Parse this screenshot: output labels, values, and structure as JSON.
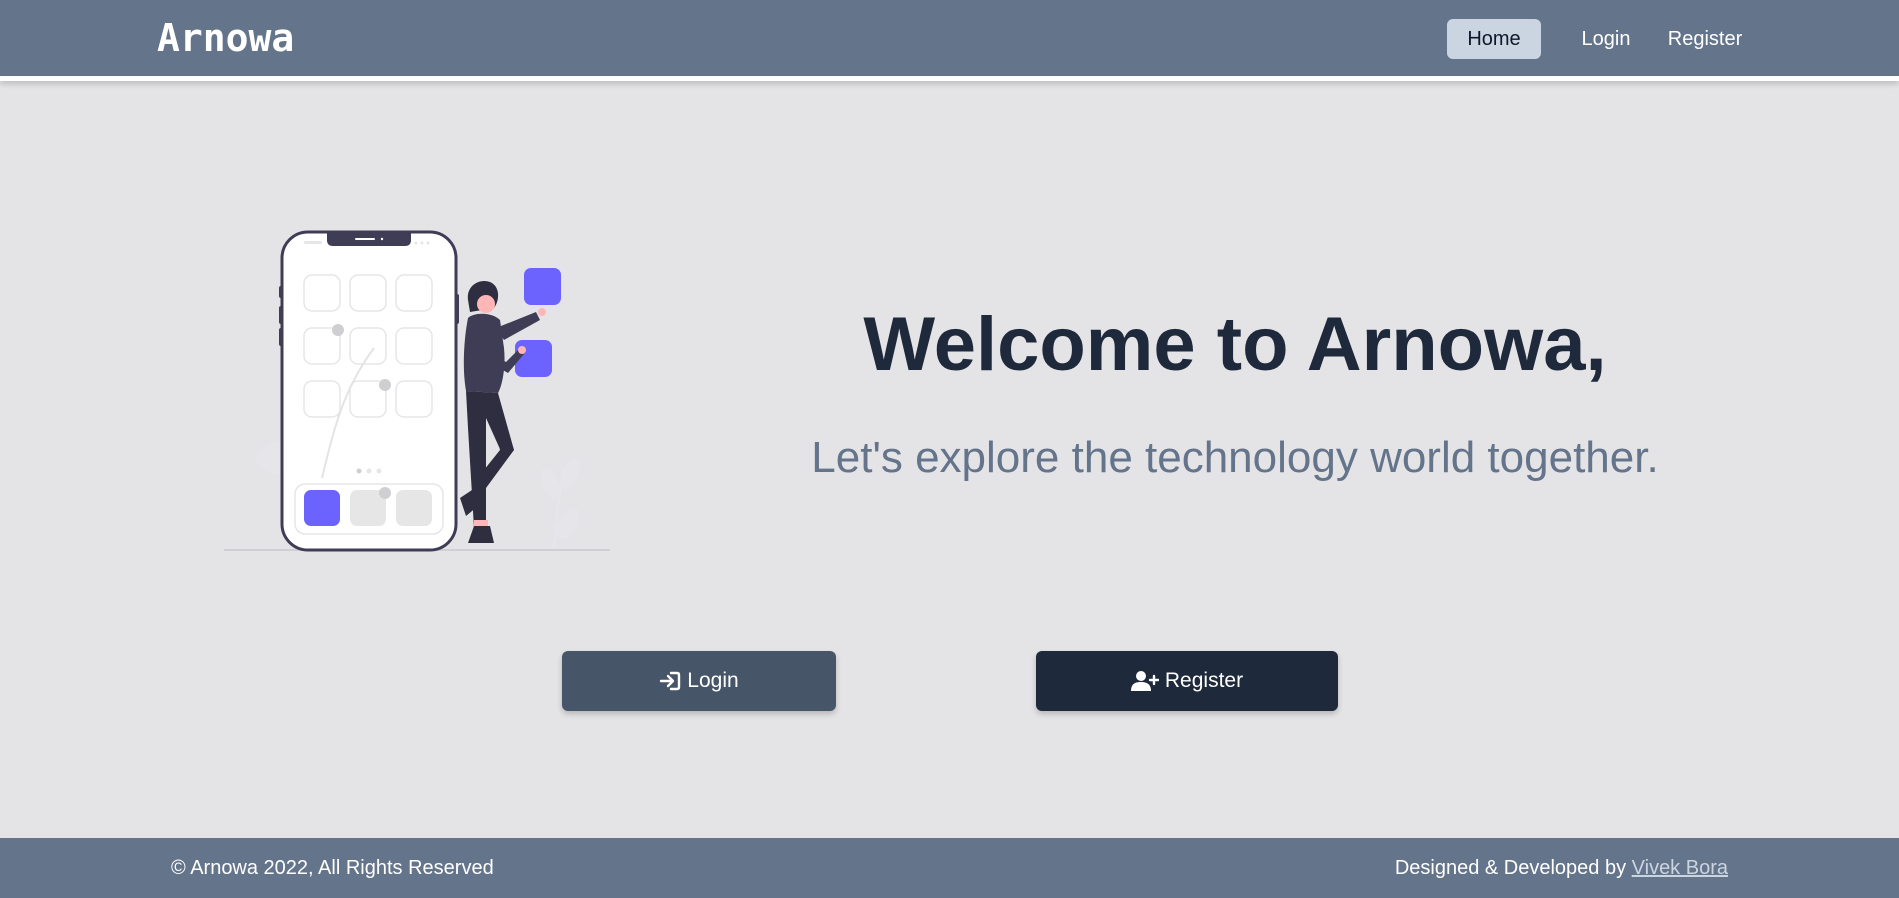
{
  "header": {
    "brand": "Arnowa",
    "nav": {
      "home": "Home",
      "login": "Login",
      "register": "Register"
    }
  },
  "hero": {
    "title": "Welcome to Arnowa,",
    "subtitle": "Let's explore the technology world together.",
    "illustration": "woman-with-phone-apps-illustration"
  },
  "actions": {
    "login": {
      "label": "Login",
      "icon": "sign-in-icon"
    },
    "register": {
      "label": "Register",
      "icon": "user-plus-icon"
    }
  },
  "footer": {
    "copyright": "© Arnowa 2022, All Rights Reserved",
    "credit_prefix": "Designed & Developed by",
    "credit_name": "Vivek Bora"
  },
  "colors": {
    "header_bg": "#64748b",
    "page_bg": "#e4e4e7",
    "title": "#1e293b",
    "subtitle": "#64748b",
    "login_button": "#475569",
    "register_button": "#1e293b",
    "accent": "#6c63ff",
    "nav_active_bg": "#cbd5e1"
  }
}
